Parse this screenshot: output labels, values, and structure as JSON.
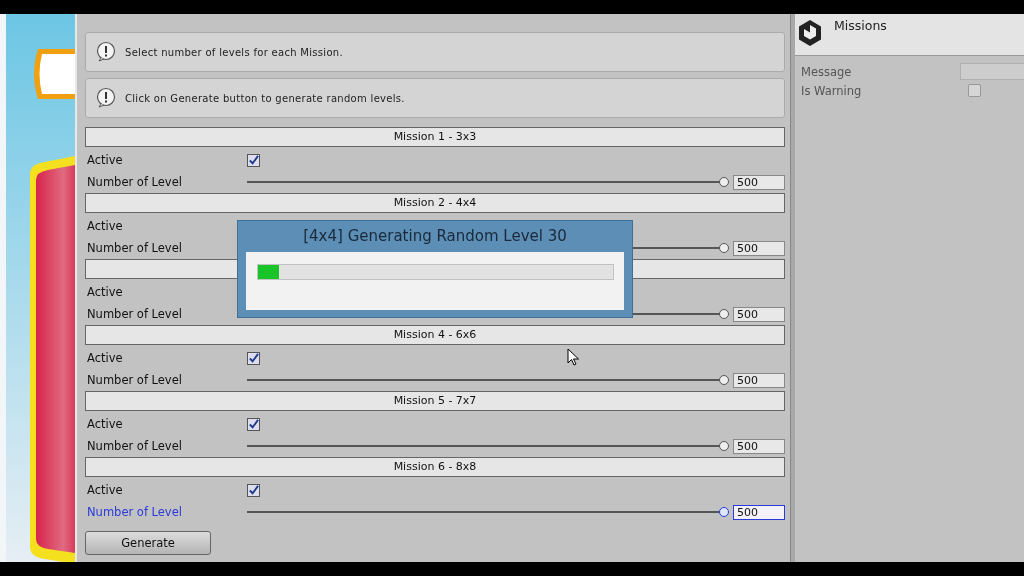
{
  "messages": [
    {
      "text": "Select number of levels for each Mission."
    },
    {
      "text": "Click on Generate button to generate random levels."
    }
  ],
  "missions": [
    {
      "title": "Mission 1 - 3x3",
      "active_label": "Active",
      "active": true,
      "count_label": "Number of Level",
      "level": 1,
      "value": "500",
      "focused": false
    },
    {
      "title": "Mission 2 - 4x4",
      "active_label": "Active",
      "count_label": "Number of Level",
      "level": 1,
      "value": "500",
      "focused": false
    },
    {
      "active_label": "Active",
      "count_label": "Number of Level",
      "level": 1,
      "value": "500",
      "focused": false
    },
    {
      "title": "Mission 4 - 6x6",
      "active_label": "Active",
      "active": true,
      "count_label": "Number of Level",
      "level": 1,
      "value": "500",
      "focused": false
    },
    {
      "title": "Mission 5 - 7x7",
      "active_label": "Active",
      "active": true,
      "count_label": "Number of Level",
      "level": 1,
      "value": "500",
      "focused": false
    },
    {
      "title": "Mission 6 - 8x8",
      "active_label": "Active",
      "active": true,
      "count_label": "Number of Level",
      "level": 1,
      "value": "500",
      "focused": true
    }
  ],
  "generate_button": "Generate",
  "progress_dialog": {
    "title": "[4x4] Generating Random Level 30",
    "level": 0.06
  },
  "inspector": {
    "title": "Missions",
    "fields": [
      {
        "kind": "text",
        "label": "Message"
      },
      {
        "kind": "checkbox",
        "label": "Is Warning",
        "checked": false
      }
    ]
  }
}
